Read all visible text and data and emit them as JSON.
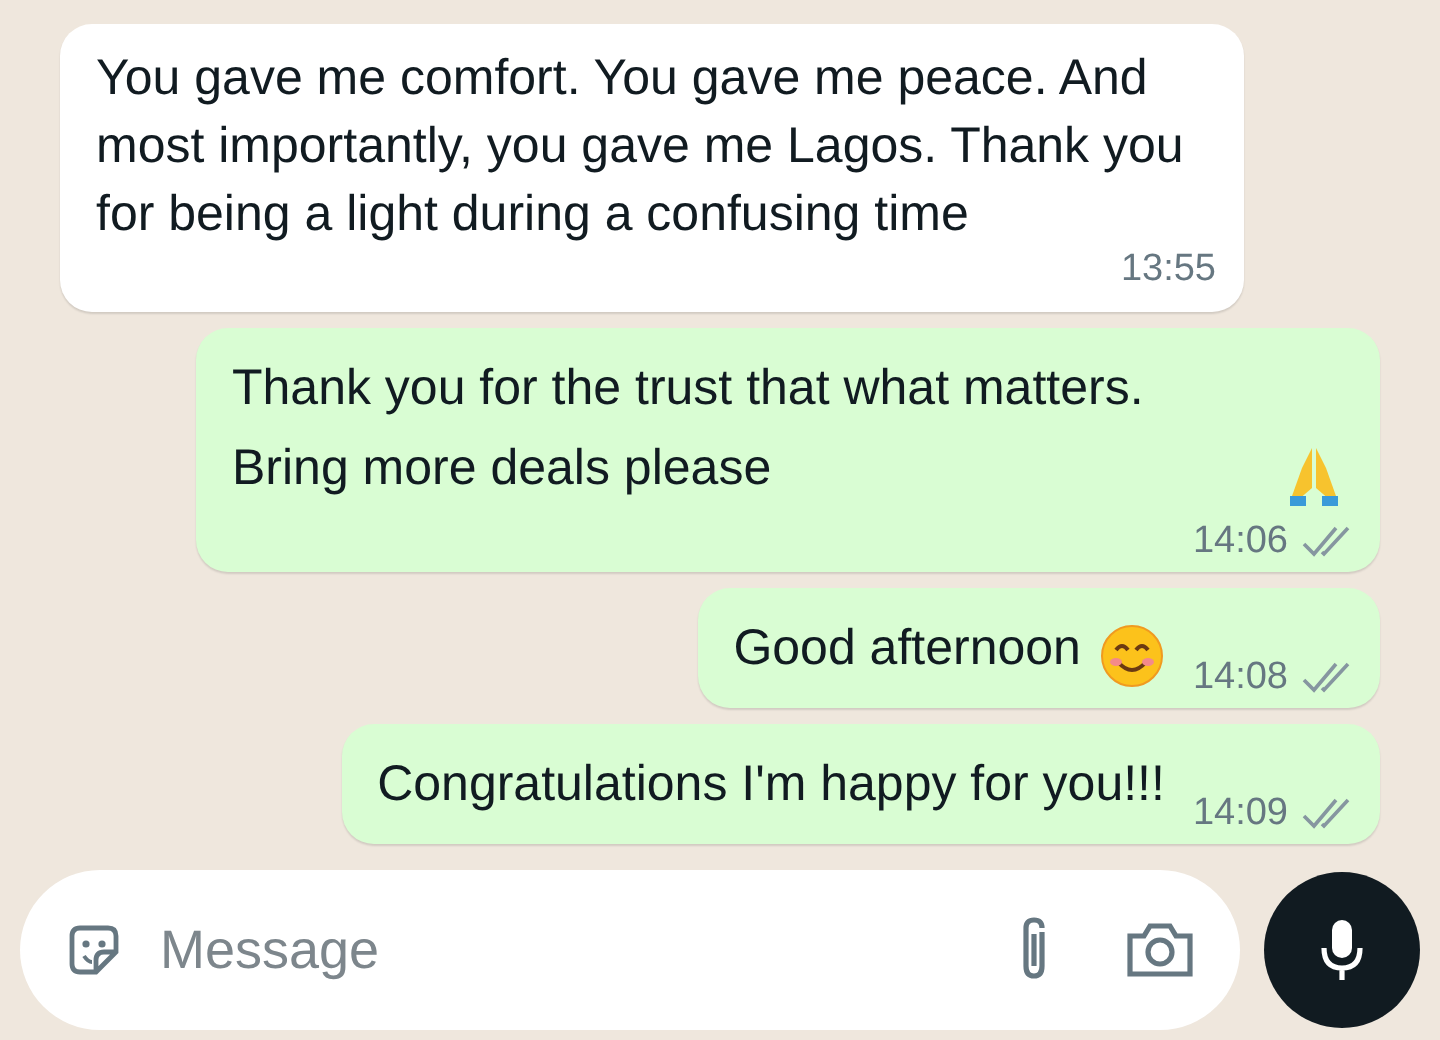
{
  "messages": [
    {
      "kind": "incoming",
      "text": "You gave me comfort. You gave me peace. And most importantly, you gave me Lagos. Thank you for being a light during a confusing time",
      "time": "13:55"
    },
    {
      "kind": "outgoing",
      "text": "Thank you for the trust that what matters. Bring more deals please",
      "time": "14:06",
      "emoji": {
        "kind": "praying-hands"
      },
      "read": false
    },
    {
      "kind": "outgoing",
      "text": "Good afternoon",
      "time": "14:08",
      "emoji": {
        "kind": "smiling-face"
      },
      "read": false
    },
    {
      "kind": "outgoing",
      "text": "Congratulations I'm happy for you!!!",
      "time": "14:09",
      "read": false
    }
  ],
  "composer": {
    "placeholder": "Message"
  }
}
